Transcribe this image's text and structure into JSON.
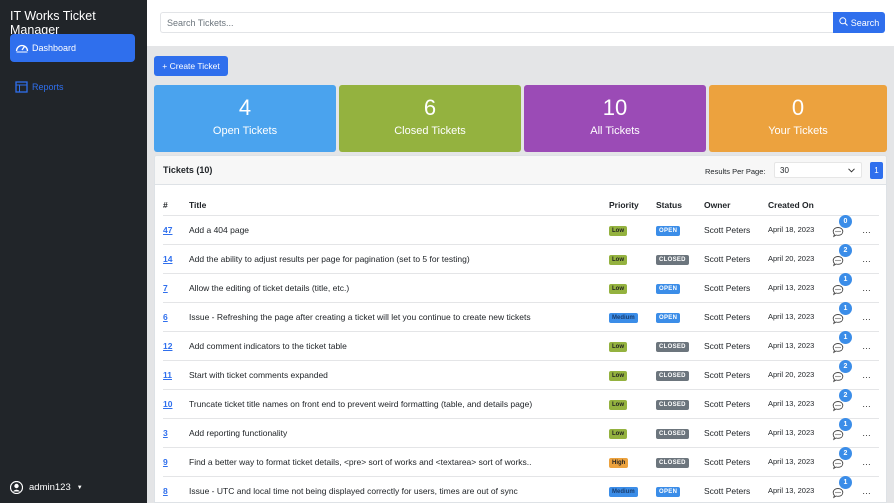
{
  "app": {
    "title": "IT Works Ticket Manager"
  },
  "sidebar": {
    "items": [
      {
        "label": "Dashboard",
        "icon": "speedometer-icon",
        "active": true
      },
      {
        "label": "Reports",
        "icon": "table-icon",
        "active": false
      }
    ],
    "user": {
      "name": "admin123"
    }
  },
  "search": {
    "placeholder": "Search Tickets...",
    "button_label": "Search"
  },
  "create_button": "+ Create Ticket",
  "stats": [
    {
      "value": "4",
      "label": "Open Tickets",
      "color": "#4aa3ee"
    },
    {
      "value": "6",
      "label": "Closed Tickets",
      "color": "#94b23f"
    },
    {
      "value": "10",
      "label": "All Tickets",
      "color": "#9b4bb6"
    },
    {
      "value": "0",
      "label": "Your Tickets",
      "color": "#eca23e"
    }
  ],
  "tickets_panel": {
    "title": "Tickets (10)",
    "results_per_page_label": "Results Per Page:",
    "results_per_page_value": "30",
    "current_page": "1",
    "columns": [
      "#",
      "Title",
      "Priority",
      "Status",
      "Owner",
      "Created On"
    ],
    "rows": [
      {
        "id": "47",
        "title": "Add a 404 page",
        "priority": "Low",
        "status": "OPEN",
        "owner": "Scott Peters",
        "created": "April 18, 2023",
        "comments": "0"
      },
      {
        "id": "14",
        "title": "Add the ability to adjust results per page for pagination (set to 5 for testing)",
        "priority": "Low",
        "status": "CLOSED",
        "owner": "Scott Peters",
        "created": "April 20, 2023",
        "comments": "2"
      },
      {
        "id": "7",
        "title": "Allow the editing of ticket details (title, etc.)",
        "priority": "Low",
        "status": "OPEN",
        "owner": "Scott Peters",
        "created": "April 13, 2023",
        "comments": "1"
      },
      {
        "id": "6",
        "title": "Issue - Refreshing the page after creating a ticket will let you continue to create new tickets",
        "priority": "Medium",
        "status": "OPEN",
        "owner": "Scott Peters",
        "created": "April 13, 2023",
        "comments": "1"
      },
      {
        "id": "12",
        "title": "Add comment indicators to the ticket table",
        "priority": "Low",
        "status": "CLOSED",
        "owner": "Scott Peters",
        "created": "April 13, 2023",
        "comments": "1"
      },
      {
        "id": "11",
        "title": "Start with ticket comments expanded",
        "priority": "Low",
        "status": "CLOSED",
        "owner": "Scott Peters",
        "created": "April 20, 2023",
        "comments": "2"
      },
      {
        "id": "10",
        "title": "Truncate ticket title names on front end to prevent weird formatting (table, and details page)",
        "priority": "Low",
        "status": "CLOSED",
        "owner": "Scott Peters",
        "created": "April 13, 2023",
        "comments": "2"
      },
      {
        "id": "3",
        "title": "Add reporting functionality",
        "priority": "Low",
        "status": "CLOSED",
        "owner": "Scott Peters",
        "created": "April 13, 2023",
        "comments": "1"
      },
      {
        "id": "9",
        "title": "Find a better way to format ticket details, <pre> sort of works and <textarea> sort of works..",
        "priority": "High",
        "status": "CLOSED",
        "owner": "Scott Peters",
        "created": "April 13, 2023",
        "comments": "2"
      },
      {
        "id": "8",
        "title": "Issue - UTC and local time not being displayed correctly for users, times are out of sync",
        "priority": "Medium",
        "status": "OPEN",
        "owner": "Scott Peters",
        "created": "April 13, 2023",
        "comments": "1"
      }
    ]
  },
  "colors": {
    "accent": "#2f6fed",
    "priority": {
      "Low": "#94b23f",
      "Medium": "#3b8de8",
      "High": "#eca23e"
    },
    "status": {
      "OPEN": "#3b8de8",
      "CLOSED": "#6c757d"
    }
  }
}
